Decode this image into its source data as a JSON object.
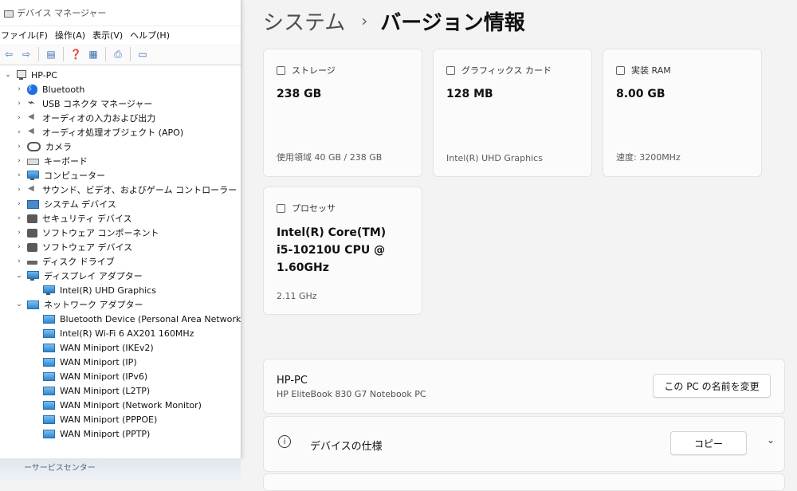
{
  "devmgr": {
    "title": "デバイス マネージャー",
    "menu": [
      "ファイル(F)",
      "操作(A)",
      "表示(V)",
      "ヘルプ(H)"
    ],
    "tree": [
      {
        "label": "HP-PC",
        "icon": "pc-icon",
        "expanded": true,
        "level": 0
      },
      {
        "label": "Bluetooth",
        "icon": "bluetooth-icon",
        "level": 1
      },
      {
        "label": "USB コネクタ マネージャー",
        "icon": "usb-icon",
        "level": 1
      },
      {
        "label": "オーディオの入力および出力",
        "icon": "speaker-icon",
        "level": 1
      },
      {
        "label": "オーディオ処理オブジェクト (APO)",
        "icon": "speaker-icon",
        "level": 1
      },
      {
        "label": "カメラ",
        "icon": "camera-icon",
        "level": 1
      },
      {
        "label": "キーボード",
        "icon": "keyboard-icon",
        "level": 1
      },
      {
        "label": "コンピューター",
        "icon": "monitor-icon",
        "level": 1
      },
      {
        "label": "サウンド、ビデオ、およびゲーム コントローラー",
        "icon": "speaker-icon",
        "level": 1
      },
      {
        "label": "システム デバイス",
        "icon": "chip-icon",
        "level": 1
      },
      {
        "label": "セキュリティ デバイス",
        "icon": "gear-icon",
        "level": 1
      },
      {
        "label": "ソフトウェア コンポーネント",
        "icon": "gear-icon",
        "level": 1
      },
      {
        "label": "ソフトウェア デバイス",
        "icon": "gear-icon",
        "level": 1
      },
      {
        "label": "ディスク ドライブ",
        "icon": "disk-icon",
        "level": 1
      },
      {
        "label": "ディスプレイ アダプター",
        "icon": "monitor-icon",
        "expanded": true,
        "level": 1
      },
      {
        "label": "Intel(R) UHD Graphics",
        "icon": "monitor-icon",
        "level": 2
      },
      {
        "label": "ネットワーク アダプター",
        "icon": "network-icon",
        "expanded": true,
        "level": 1
      },
      {
        "label": "Bluetooth Device (Personal Area Network)",
        "icon": "network-icon",
        "level": 2
      },
      {
        "label": "Intel(R) Wi-Fi 6 AX201 160MHz",
        "icon": "network-icon",
        "level": 2
      },
      {
        "label": "WAN Miniport (IKEv2)",
        "icon": "network-icon",
        "level": 2
      },
      {
        "label": "WAN Miniport (IP)",
        "icon": "network-icon",
        "level": 2
      },
      {
        "label": "WAN Miniport (IPv6)",
        "icon": "network-icon",
        "level": 2
      },
      {
        "label": "WAN Miniport (L2TP)",
        "icon": "network-icon",
        "level": 2
      },
      {
        "label": "WAN Miniport (Network Monitor)",
        "icon": "network-icon",
        "level": 2
      },
      {
        "label": "WAN Miniport (PPPOE)",
        "icon": "network-icon",
        "level": 2
      },
      {
        "label": "WAN Miniport (PPTP)",
        "icon": "network-icon",
        "level": 2
      }
    ]
  },
  "desktop": {
    "text": "ーサービスセンター"
  },
  "settings": {
    "crumb_parent": "システム",
    "crumb_current": "バージョン情報",
    "storage": {
      "label": "ストレージ",
      "value": "238 GB",
      "detail": "使用領域 40 GB / 238 GB"
    },
    "graphics": {
      "label": "グラフィックス カード",
      "value": "128 MB",
      "detail": "Intel(R) UHD Graphics"
    },
    "ram": {
      "label": "実装 RAM",
      "value": "8.00 GB",
      "detail": "速度: 3200MHz"
    },
    "processor": {
      "label": "プロセッサ",
      "value": "Intel(R) Core(TM) i5-10210U CPU @ 1.60GHz",
      "detail": "2.11 GHz"
    },
    "pc": {
      "name": "HP-PC",
      "model": "HP EliteBook 830 G7 Notebook PC",
      "rename_button": "この PC の名前を変更"
    },
    "specs": {
      "title": "デバイスの仕様",
      "copy_button": "コピー"
    }
  }
}
